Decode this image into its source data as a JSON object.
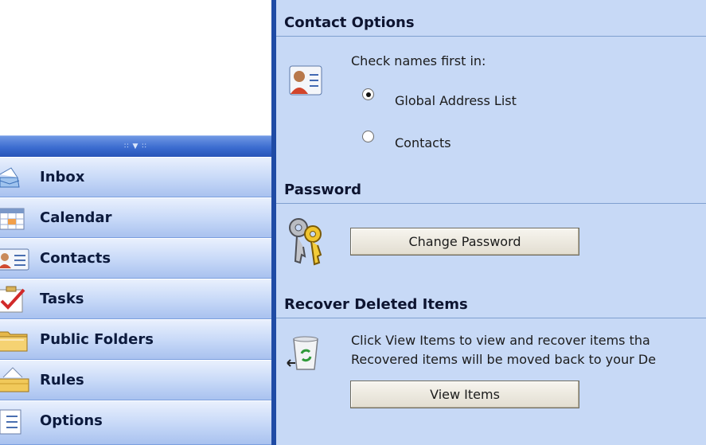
{
  "nav": {
    "handle_glyph": "∶∶ ▼ ∶∶",
    "items": [
      {
        "label": "Inbox",
        "icon": "inbox-icon"
      },
      {
        "label": "Calendar",
        "icon": "calendar-icon"
      },
      {
        "label": "Contacts",
        "icon": "contacts-icon"
      },
      {
        "label": "Tasks",
        "icon": "tasks-icon"
      },
      {
        "label": "Public Folders",
        "icon": "public-folders-icon"
      },
      {
        "label": "Rules",
        "icon": "rules-icon"
      },
      {
        "label": "Options",
        "icon": "options-icon"
      }
    ]
  },
  "contact_options": {
    "title": "Contact Options",
    "check_names_label": "Check names first in:",
    "radio_options": [
      {
        "label": "Global Address List",
        "checked": true
      },
      {
        "label": "Contacts",
        "checked": false
      }
    ]
  },
  "password": {
    "title": "Password",
    "change_button": "Change Password"
  },
  "recover": {
    "title": "Recover Deleted Items",
    "line1": "Click View Items to view and recover items tha",
    "line2": "Recovered items will be moved back to your De",
    "view_button": "View Items"
  },
  "colors": {
    "pane_bg": "#c7d9f6",
    "splitter": "#1f4ba5",
    "nav_handle": "#3c6dd0"
  }
}
